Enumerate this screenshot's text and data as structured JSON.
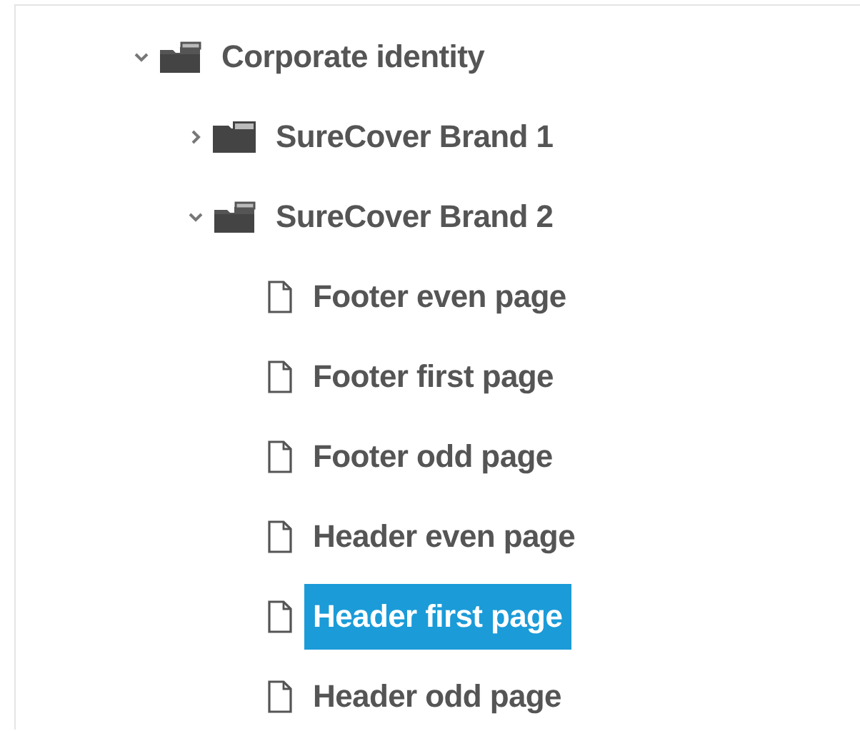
{
  "tree": [
    {
      "kind": "folder",
      "label": "Corporate identity",
      "expanded": true,
      "selected": false,
      "children": [
        {
          "kind": "folder",
          "label": "SureCover Brand 1",
          "expanded": false,
          "selected": false
        },
        {
          "kind": "folder",
          "label": "SureCover Brand 2",
          "expanded": true,
          "selected": false,
          "children": [
            {
              "kind": "file",
              "label": "Footer even page",
              "selected": false
            },
            {
              "kind": "file",
              "label": "Footer first page",
              "selected": false
            },
            {
              "kind": "file",
              "label": "Footer odd page",
              "selected": false
            },
            {
              "kind": "file",
              "label": "Header even page",
              "selected": false
            },
            {
              "kind": "file",
              "label": "Header first page",
              "selected": true
            },
            {
              "kind": "file",
              "label": "Header odd page",
              "selected": false
            }
          ]
        }
      ]
    }
  ]
}
